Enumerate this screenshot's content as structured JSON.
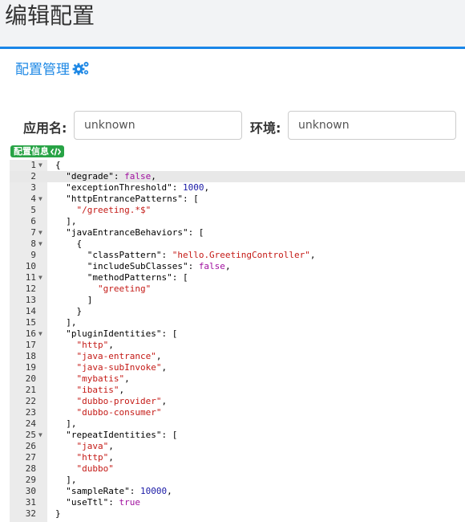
{
  "page": {
    "title": "编辑配置"
  },
  "panel": {
    "title": "配置管理",
    "icon": "cogs-icon"
  },
  "form": {
    "app_label": "应用名:",
    "app_value": "unknown",
    "env_label": "环境:",
    "env_value": "unknown"
  },
  "badge": {
    "label": "配置信息",
    "icon": "code-icon"
  },
  "editor": {
    "active_line": 2,
    "fold_lines": [
      1,
      4,
      7,
      8,
      11,
      16,
      25
    ],
    "lines": [
      [
        [
          "p",
          "{"
        ]
      ],
      [
        [
          "p",
          "  \"degrade\": "
        ],
        [
          "b",
          "false"
        ],
        [
          "p",
          ","
        ]
      ],
      [
        [
          "p",
          "  \"exceptionThreshold\": "
        ],
        [
          "n",
          "1000"
        ],
        [
          "p",
          ","
        ]
      ],
      [
        [
          "p",
          "  \"httpEntrancePatterns\": ["
        ]
      ],
      [
        [
          "s",
          "    \"/greeting.*$\""
        ]
      ],
      [
        [
          "p",
          "  ],"
        ]
      ],
      [
        [
          "p",
          "  \"javaEntranceBehaviors\": ["
        ]
      ],
      [
        [
          "p",
          "    {"
        ]
      ],
      [
        [
          "p",
          "      \"classPattern\": "
        ],
        [
          "s",
          "\"hello.GreetingController\""
        ],
        [
          "p",
          ","
        ]
      ],
      [
        [
          "p",
          "      \"includeSubClasses\": "
        ],
        [
          "b",
          "false"
        ],
        [
          "p",
          ","
        ]
      ],
      [
        [
          "p",
          "      \"methodPatterns\": ["
        ]
      ],
      [
        [
          "s",
          "        \"greeting\""
        ]
      ],
      [
        [
          "p",
          "      ]"
        ]
      ],
      [
        [
          "p",
          "    }"
        ]
      ],
      [
        [
          "p",
          "  ],"
        ]
      ],
      [
        [
          "p",
          "  \"pluginIdentities\": ["
        ]
      ],
      [
        [
          "s",
          "    \"http\""
        ],
        [
          "p",
          ","
        ]
      ],
      [
        [
          "s",
          "    \"java-entrance\""
        ],
        [
          "p",
          ","
        ]
      ],
      [
        [
          "s",
          "    \"java-subInvoke\""
        ],
        [
          "p",
          ","
        ]
      ],
      [
        [
          "s",
          "    \"mybatis\""
        ],
        [
          "p",
          ","
        ]
      ],
      [
        [
          "s",
          "    \"ibatis\""
        ],
        [
          "p",
          ","
        ]
      ],
      [
        [
          "s",
          "    \"dubbo-provider\""
        ],
        [
          "p",
          ","
        ]
      ],
      [
        [
          "s",
          "    \"dubbo-consumer\""
        ]
      ],
      [
        [
          "p",
          "  ],"
        ]
      ],
      [
        [
          "p",
          "  \"repeatIdentities\": ["
        ]
      ],
      [
        [
          "s",
          "    \"java\""
        ],
        [
          "p",
          ","
        ]
      ],
      [
        [
          "s",
          "    \"http\""
        ],
        [
          "p",
          ","
        ]
      ],
      [
        [
          "s",
          "    \"dubbo\""
        ]
      ],
      [
        [
          "p",
          "  ],"
        ]
      ],
      [
        [
          "p",
          "  \"sampleRate\": "
        ],
        [
          "n",
          "10000"
        ],
        [
          "p",
          ","
        ]
      ],
      [
        [
          "p",
          "  \"useTtl\": "
        ],
        [
          "b",
          "true"
        ]
      ],
      [
        [
          "p",
          "}"
        ]
      ]
    ]
  }
}
